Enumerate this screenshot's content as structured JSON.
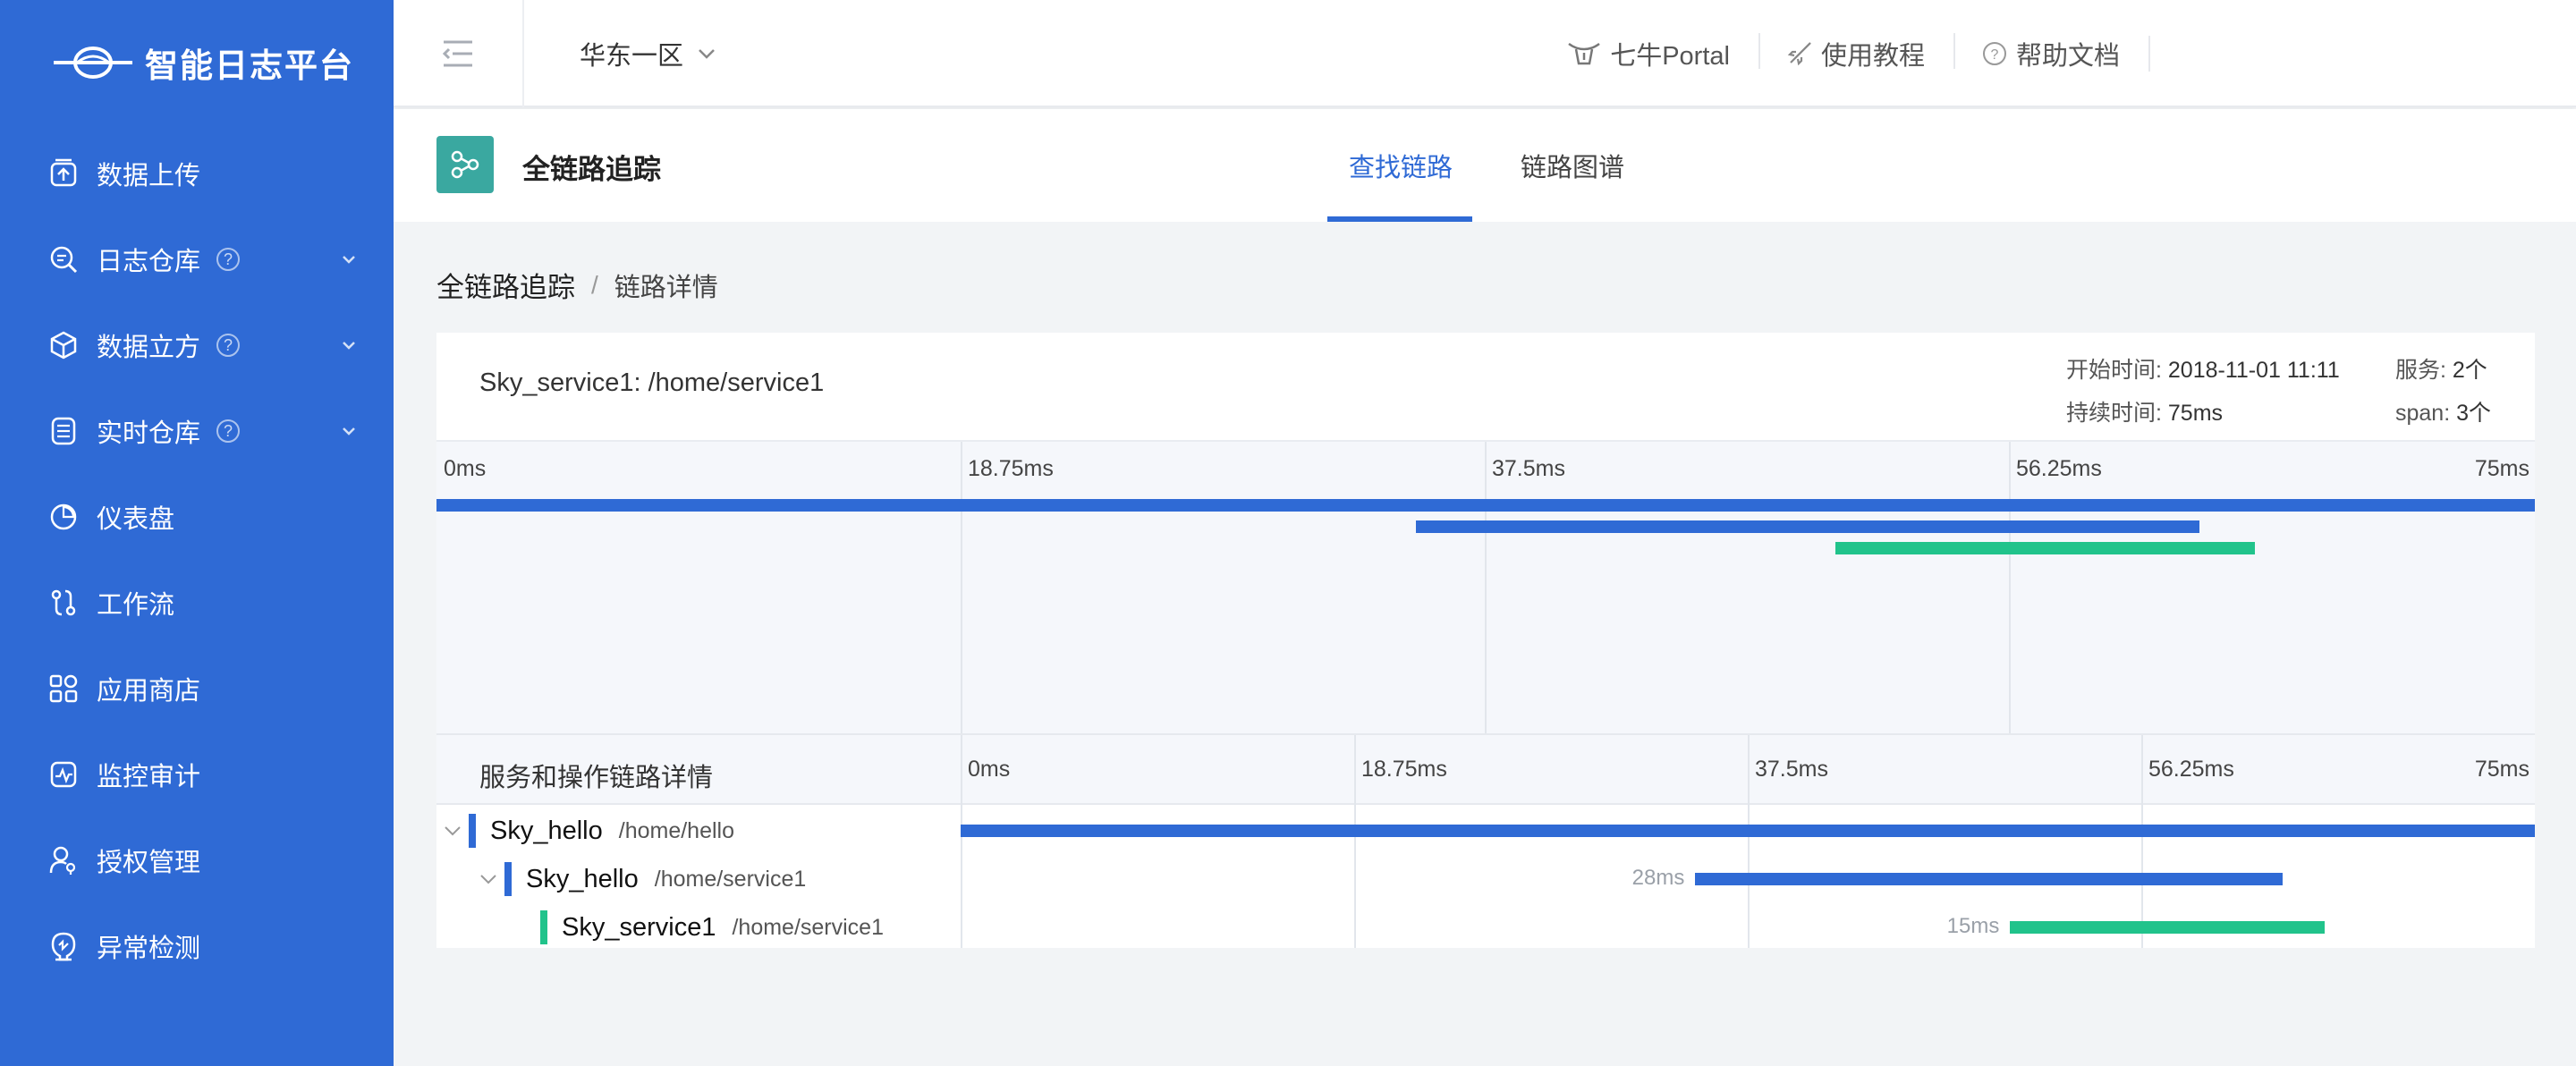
{
  "brand": {
    "name": "智能日志平台"
  },
  "sidebar": {
    "items": [
      {
        "label": "数据上传",
        "icon": "upload-icon",
        "help": false,
        "expand": false
      },
      {
        "label": "日志仓库",
        "icon": "log-search-icon",
        "help": true,
        "expand": true
      },
      {
        "label": "数据立方",
        "icon": "cube-icon",
        "help": true,
        "expand": true
      },
      {
        "label": "实时仓库",
        "icon": "database-icon",
        "help": true,
        "expand": true
      },
      {
        "label": "仪表盘",
        "icon": "dashboard-icon",
        "help": false,
        "expand": false
      },
      {
        "label": "工作流",
        "icon": "workflow-icon",
        "help": false,
        "expand": false
      },
      {
        "label": "应用商店",
        "icon": "apps-icon",
        "help": false,
        "expand": false
      },
      {
        "label": "监控审计",
        "icon": "monitor-icon",
        "help": false,
        "expand": false
      },
      {
        "label": "授权管理",
        "icon": "user-key-icon",
        "help": false,
        "expand": false
      },
      {
        "label": "异常检测",
        "icon": "anomaly-icon",
        "help": false,
        "expand": false
      }
    ],
    "help_glyph": "?"
  },
  "header": {
    "region": "华东一区",
    "links": [
      {
        "label": "七牛Portal",
        "icon": "portal-icon"
      },
      {
        "label": "使用教程",
        "icon": "rocket-icon"
      },
      {
        "label": "帮助文档",
        "icon": "help-circle-icon"
      }
    ]
  },
  "subheader": {
    "title": "全链路追踪",
    "tabs": [
      {
        "label": "查找链路",
        "active": true
      },
      {
        "label": "链路图谱",
        "active": false
      }
    ]
  },
  "breadcrumb": {
    "root": "全链路追踪",
    "separator": "/",
    "current": "链路详情"
  },
  "trace": {
    "title": "Sky_service1: /home/service1",
    "start_label": "开始时间:",
    "start_value": "2018-11-01 11:11",
    "duration_label": "持续时间:",
    "duration_value": "75ms",
    "services_label": "服务:",
    "services_value": "2个",
    "span_label": "span:",
    "span_value": "3个"
  },
  "timeline": {
    "ticks": [
      "0ms",
      "18.75ms",
      "37.5ms",
      "56.25ms",
      "75ms"
    ],
    "total_ms": 75,
    "detail_header": "服务和操作链路详情"
  },
  "chart_data": {
    "type": "gantt",
    "x_unit": "ms",
    "xlim": [
      0,
      75
    ],
    "spans": [
      {
        "service": "Sky_hello",
        "operation": "/home/hello",
        "start": 0,
        "end": 75,
        "duration_label": "",
        "color": "#2f6ad5",
        "depth": 0,
        "collapsible": true
      },
      {
        "service": "Sky_hello",
        "operation": "/home/service1",
        "start": 35,
        "end": 63,
        "duration_label": "28ms",
        "color": "#2f6ad5",
        "depth": 1,
        "collapsible": true
      },
      {
        "service": "Sky_service1",
        "operation": "/home/service1",
        "start": 50,
        "end": 65,
        "duration_label": "15ms",
        "color": "#21c38b",
        "depth": 2,
        "collapsible": false
      }
    ]
  },
  "colors": {
    "sidebar": "#2f6ad5",
    "accent": "#2f6ad5",
    "green": "#21c38b",
    "teal": "#3aa8a0"
  }
}
